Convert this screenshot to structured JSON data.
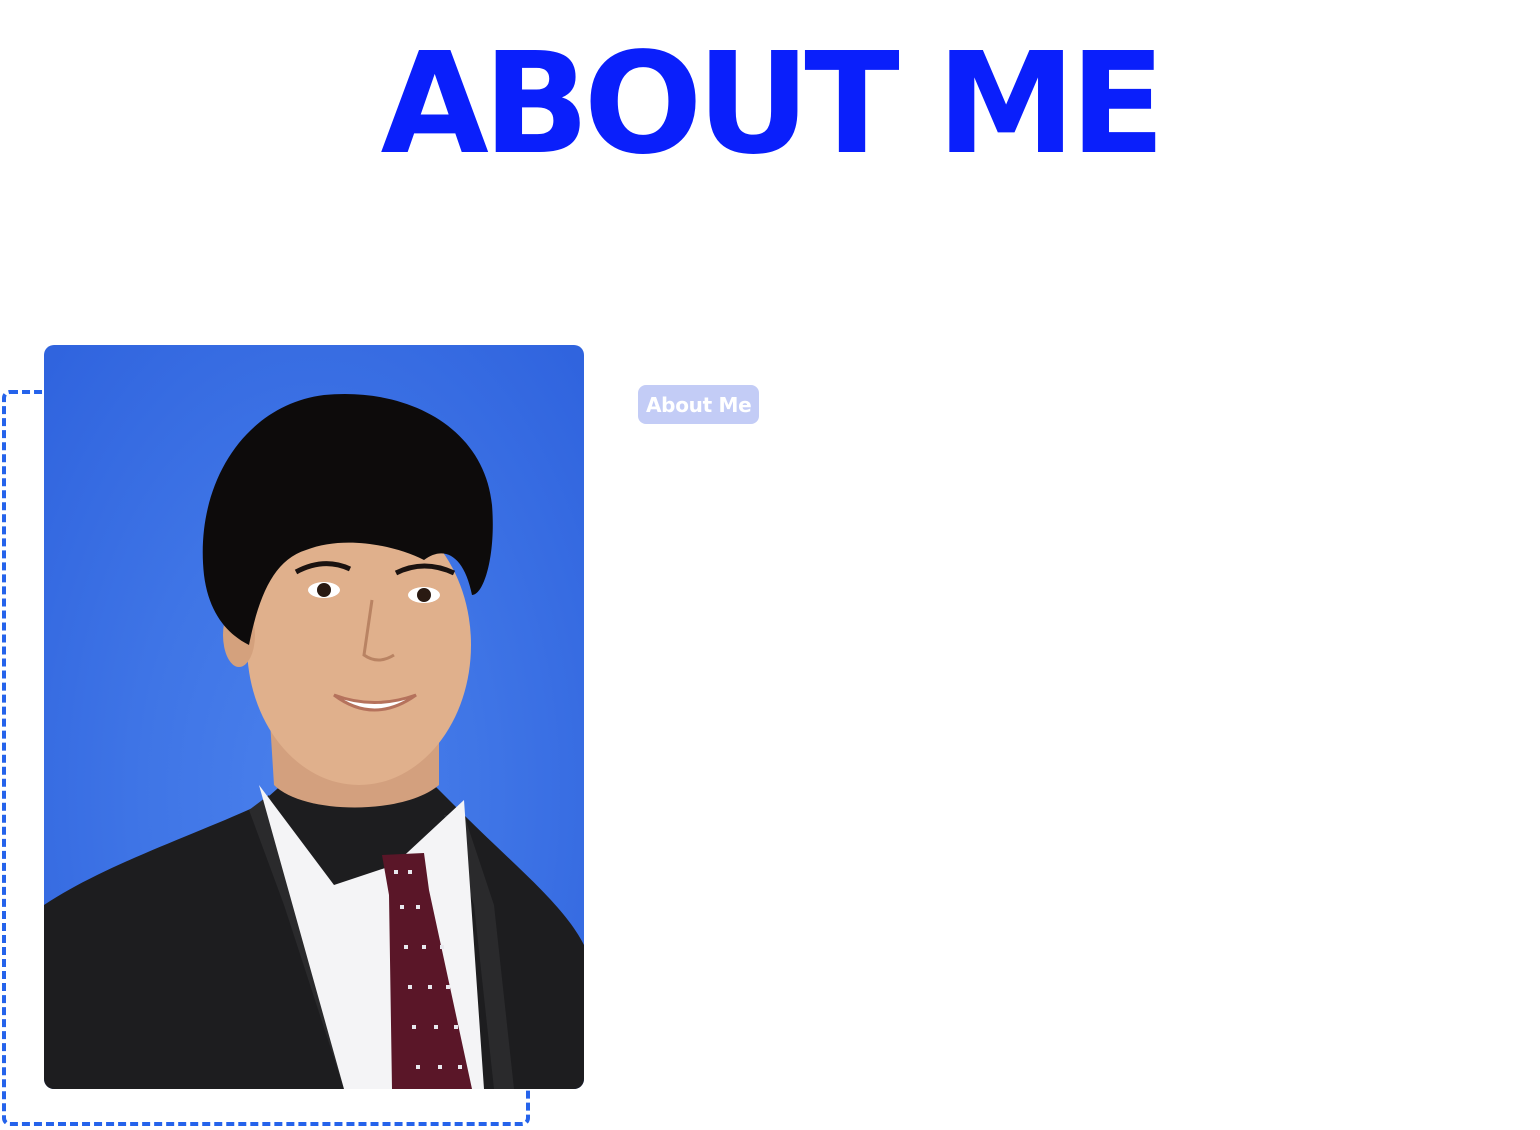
{
  "header": {
    "title": "ABOUT ME"
  },
  "about": {
    "badge_label": "About Me"
  },
  "colors": {
    "accent": "#0a1ffb",
    "frame": "#2563eb",
    "photo_background": "#3f75e6",
    "badge_background": "#c3ccf6"
  }
}
